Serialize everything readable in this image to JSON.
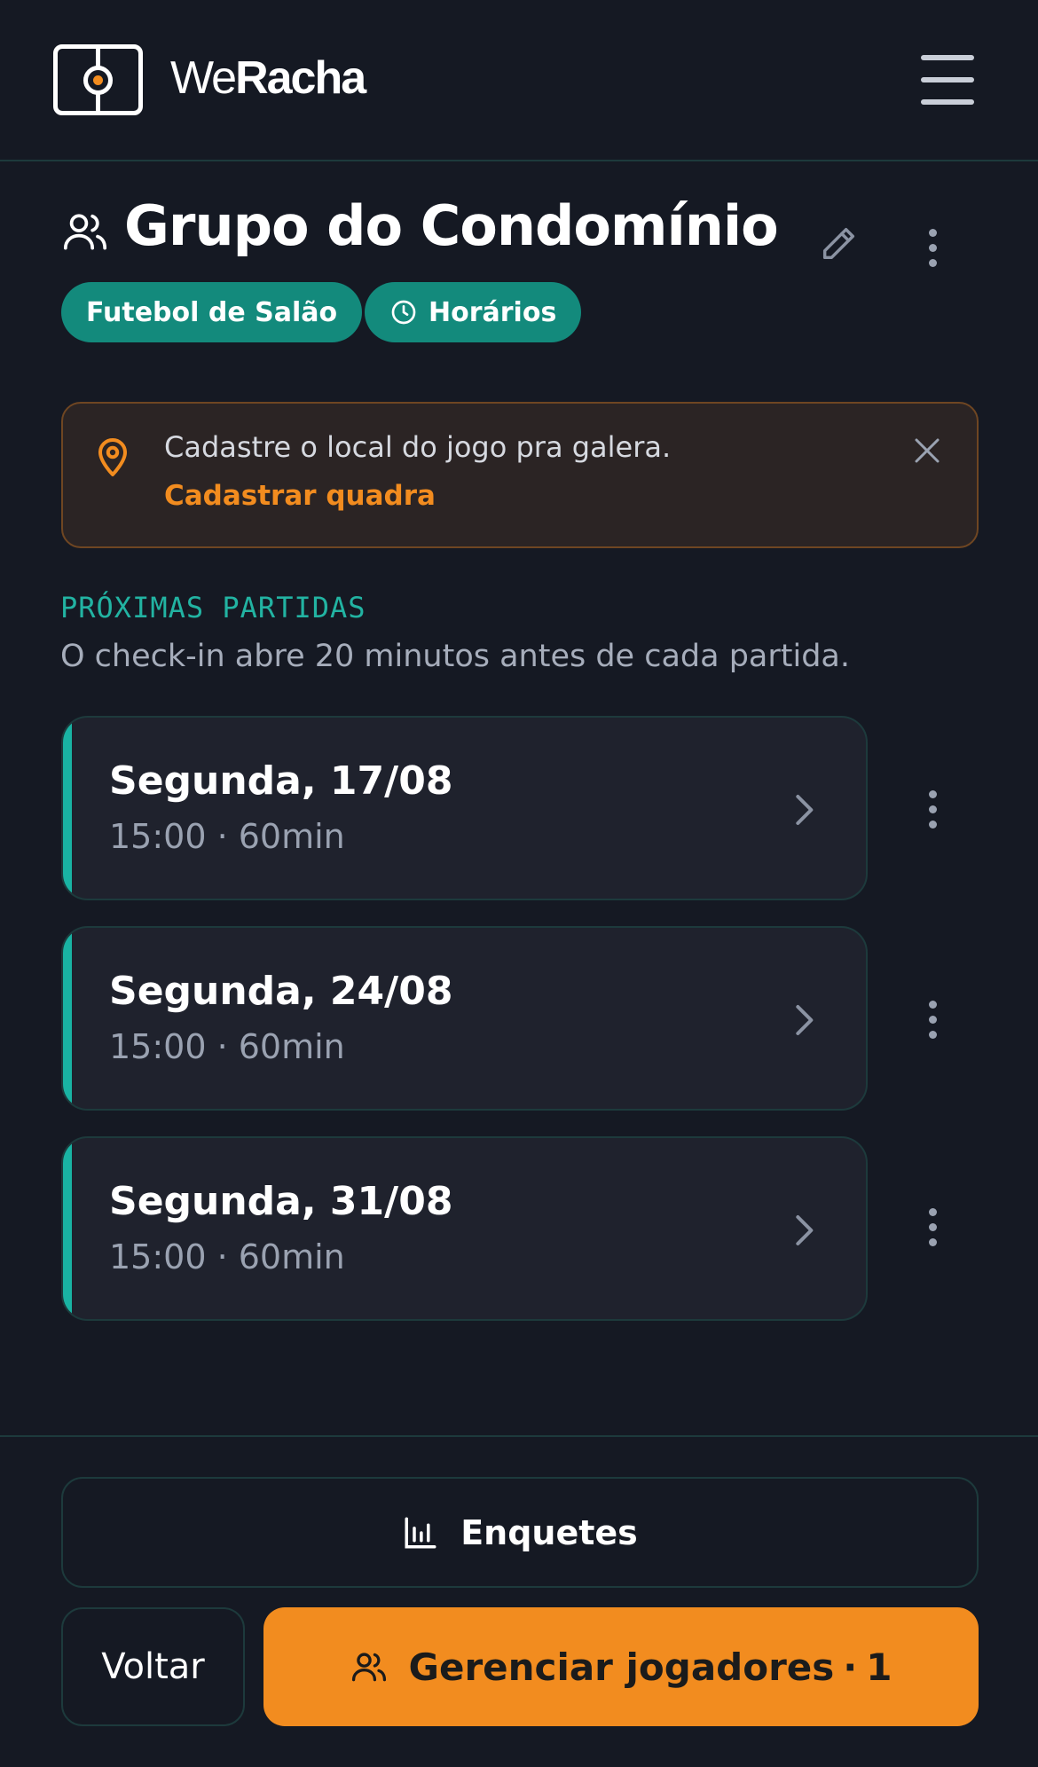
{
  "header": {
    "brand_prefix": "We",
    "brand_suffix": "Racha",
    "menu_icon": "hamburger-icon"
  },
  "group": {
    "title": "Grupo do Condomínio",
    "chips": [
      {
        "label": "Futebol de Salão"
      },
      {
        "label": "Horários",
        "icon": "clock-icon"
      }
    ]
  },
  "alert": {
    "message": "Cadastre o local do jogo pra galera.",
    "link": "Cadastrar quadra"
  },
  "upcoming": {
    "label": "PRÓXIMAS PARTIDAS",
    "subtitle": "O check-in abre 20 minutos antes de cada partida.",
    "matches": [
      {
        "date": "Segunda, 17/08",
        "time": "15:00 · 60min"
      },
      {
        "date": "Segunda, 24/08",
        "time": "15:00 · 60min"
      },
      {
        "date": "Segunda, 31/08",
        "time": "15:00 · 60min"
      }
    ]
  },
  "footer": {
    "polls_label": "Enquetes",
    "back_label": "Voltar",
    "manage_label": "Gerenciar jogadores",
    "manage_separator": "·",
    "manage_count": "1"
  },
  "colors": {
    "background": "#151923",
    "accent_teal": "#19b3a3",
    "chip_teal": "#138a7c",
    "accent_orange": "#f28c1f",
    "card": "#1f222d"
  }
}
